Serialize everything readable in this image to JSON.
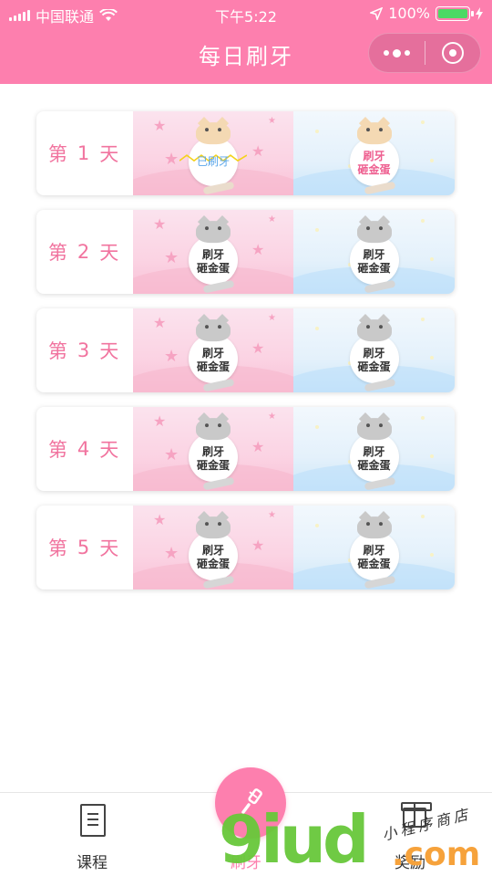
{
  "status_bar": {
    "carrier": "中国联通",
    "time": "下午5:22",
    "battery": "100%"
  },
  "nav": {
    "title": "每日刷牙"
  },
  "days": [
    {
      "prefix": "第",
      "num": "1",
      "suffix": "天",
      "slots": [
        {
          "state": "done",
          "text": "已刷牙"
        },
        {
          "state": "gold",
          "line1": "刷牙",
          "line2": "砸金蛋"
        }
      ]
    },
    {
      "prefix": "第",
      "num": "2",
      "suffix": "天",
      "slots": [
        {
          "state": "locked",
          "line1": "刷牙",
          "line2": "砸金蛋"
        },
        {
          "state": "locked",
          "line1": "刷牙",
          "line2": "砸金蛋"
        }
      ]
    },
    {
      "prefix": "第",
      "num": "3",
      "suffix": "天",
      "slots": [
        {
          "state": "locked",
          "line1": "刷牙",
          "line2": "砸金蛋"
        },
        {
          "state": "locked",
          "line1": "刷牙",
          "line2": "砸金蛋"
        }
      ]
    },
    {
      "prefix": "第",
      "num": "4",
      "suffix": "天",
      "slots": [
        {
          "state": "locked",
          "line1": "刷牙",
          "line2": "砸金蛋"
        },
        {
          "state": "locked",
          "line1": "刷牙",
          "line2": "砸金蛋"
        }
      ]
    },
    {
      "prefix": "第",
      "num": "5",
      "suffix": "天",
      "slots": [
        {
          "state": "locked",
          "line1": "刷牙",
          "line2": "砸金蛋"
        },
        {
          "state": "locked",
          "line1": "刷牙",
          "line2": "砸金蛋"
        }
      ]
    }
  ],
  "tabbar": {
    "items": [
      {
        "label": "课程",
        "icon": "book-icon"
      },
      {
        "label": "刷牙",
        "icon": "toothbrush-icon",
        "active": true
      },
      {
        "label": "奖励",
        "icon": "gift-icon"
      }
    ]
  },
  "watermark": {
    "main": "9iud",
    "domain": ".com",
    "tagline": "小程序商店"
  },
  "colors": {
    "brand_pink": "#fd7fae",
    "day_text": "#f1749f",
    "done_text": "#5aa6ea"
  }
}
